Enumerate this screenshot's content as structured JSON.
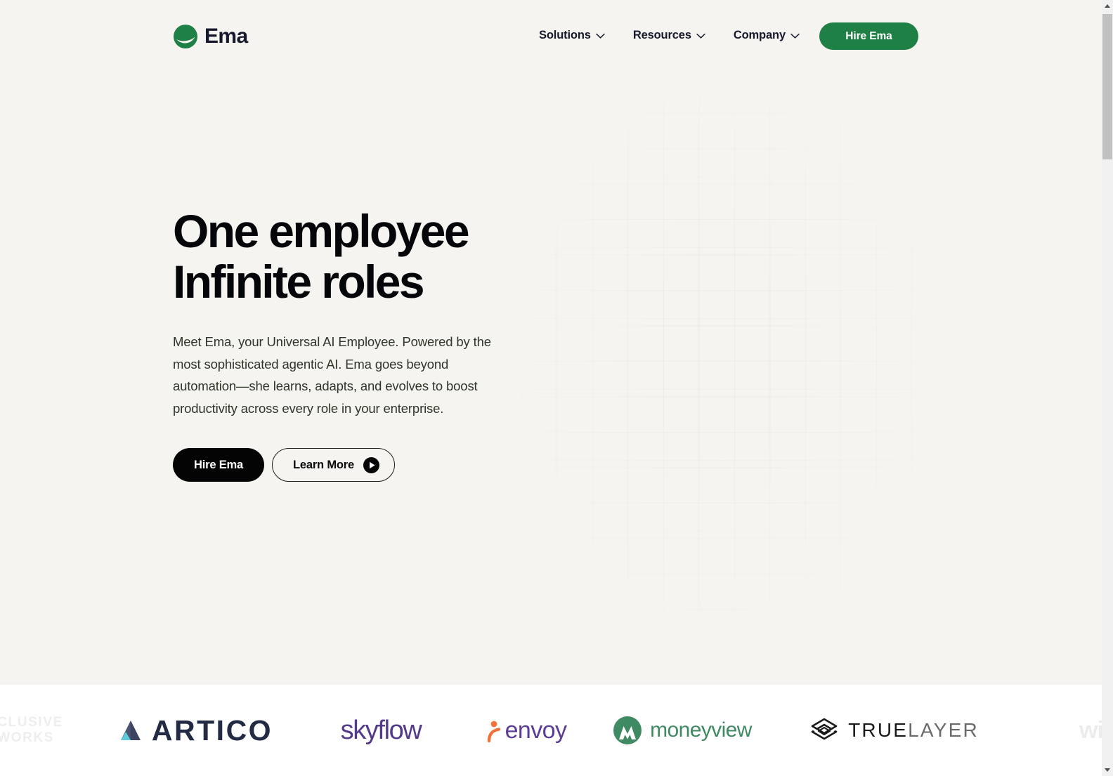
{
  "brand": {
    "name": "Ema",
    "logo_icon": "ema-leaf-circle-icon",
    "accent_green": "#1f8045",
    "text_dark": "#15192b"
  },
  "header": {
    "nav_items": [
      {
        "label": "Solutions",
        "icon": "chevron-down-icon"
      },
      {
        "label": "Resources",
        "icon": "chevron-down-icon"
      },
      {
        "label": "Company",
        "icon": "chevron-down-icon"
      }
    ],
    "cta_label": "Hire Ema"
  },
  "hero": {
    "headline_line1": "One employee",
    "headline_line2": "Infinite roles",
    "subcopy": "Meet Ema, your Universal AI Employee. Powered by the most sophisticated agentic AI. Ema goes beyond automation—she learns, adapts, and evolves to boost productivity across every role in your enterprise.",
    "primary_cta": "Hire Ema",
    "secondary_cta": "Learn More",
    "secondary_cta_icon": "play-circle-icon",
    "background_color": "#f6f4f0"
  },
  "logos": {
    "band_background": "#ffffff",
    "items": [
      {
        "name": "xclusive-networks",
        "line1": "CLUSIVE",
        "line2": "WORKS",
        "color": "#eeeeee"
      },
      {
        "name": "artico",
        "label": "ARTICO",
        "color": "#222a44",
        "accent": "#5ec8dc"
      },
      {
        "name": "skyflow",
        "label": "skyflow",
        "color": "#533a8b"
      },
      {
        "name": "envoy",
        "label": "envoy",
        "color": "#5b3c96",
        "accent": "#f2713a"
      },
      {
        "name": "moneyview",
        "label": "moneyview",
        "color": "#3f8a62"
      },
      {
        "name": "truelayer",
        "label_dark": "TRUE",
        "label_light": "LAYER",
        "color": "#1a1a1a"
      },
      {
        "name": "wi-partial",
        "label": "wi",
        "color": "#ececec"
      }
    ]
  },
  "scrollbar": {
    "up_icon": "scroll-up-arrow-icon",
    "down_icon": "scroll-down-arrow-icon"
  }
}
